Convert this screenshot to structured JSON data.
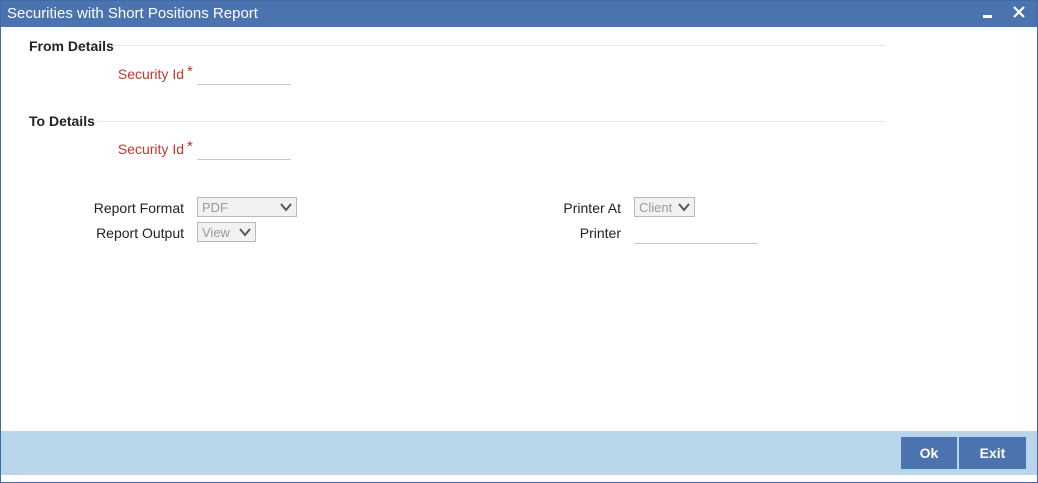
{
  "window": {
    "title": "Securities with Short Positions Report"
  },
  "from_details": {
    "heading": "From Details",
    "security_id_label": "Security Id",
    "required_mark": "*",
    "security_id_value": ""
  },
  "to_details": {
    "heading": "To Details",
    "security_id_label": "Security Id",
    "required_mark": "*",
    "security_id_value": ""
  },
  "report": {
    "format_label": "Report Format",
    "format_value": "PDF",
    "output_label": "Report Output",
    "output_value": "View",
    "printer_at_label": "Printer At",
    "printer_at_value": "Client",
    "printer_label": "Printer",
    "printer_value": ""
  },
  "footer": {
    "ok_label": "Ok",
    "exit_label": "Exit"
  },
  "icons": {
    "minimize": "minimize-icon",
    "close": "close-icon",
    "dropdown": "chevron-down-icon"
  },
  "colors": {
    "titlebar": "#4a73b0",
    "footer": "#b9d5ea",
    "required": "#c0392b"
  }
}
